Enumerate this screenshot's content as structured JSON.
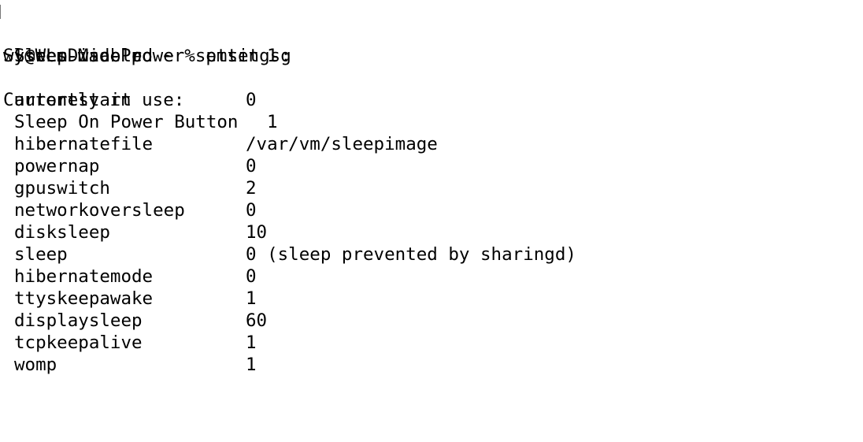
{
  "terminal": {
    "prompt": "wl@WLs-Mac-Pro ~ % pmset -g",
    "system_header": "System-wide power settings:",
    "system_settings": [
      {
        "key": "SleepDisabled",
        "value": "1"
      }
    ],
    "current_header": "Currently in use:",
    "current_settings": [
      {
        "key": "autorestart",
        "value": "0"
      },
      {
        "key": "Sleep On Power Button",
        "value": "1"
      },
      {
        "key": "hibernatefile",
        "value": "/var/vm/sleepimage"
      },
      {
        "key": "powernap",
        "value": "0"
      },
      {
        "key": "gpuswitch",
        "value": "2"
      },
      {
        "key": "networkoversleep",
        "value": "0"
      },
      {
        "key": "disksleep",
        "value": "10"
      },
      {
        "key": "sleep",
        "value": "0 (sleep prevented by sharingd)"
      },
      {
        "key": "hibernatemode",
        "value": "0"
      },
      {
        "key": "ttyskeepawake",
        "value": "1"
      },
      {
        "key": "displaysleep",
        "value": "60"
      },
      {
        "key": "tcpkeepalive",
        "value": "1"
      },
      {
        "key": "womp",
        "value": "1"
      }
    ]
  }
}
